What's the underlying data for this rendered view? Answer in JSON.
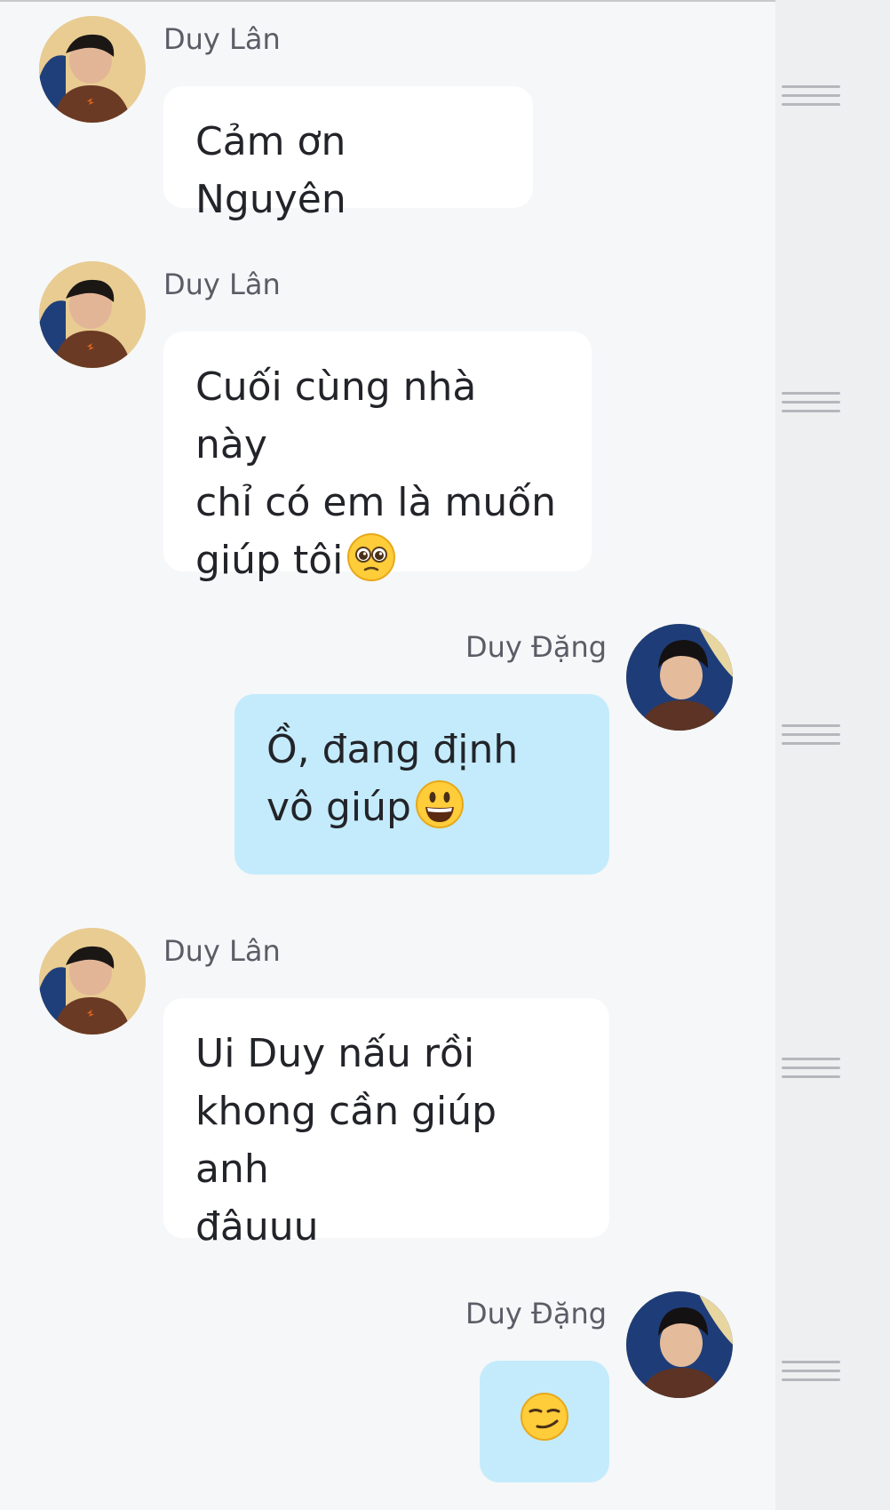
{
  "conversation": {
    "messages": [
      {
        "sender": "Duy Lân",
        "text": "Cảm ơn Nguyên",
        "direction": "incoming",
        "emoji": ""
      },
      {
        "sender": "Duy Lân",
        "text": "Cuối cùng nhà này\nchỉ có em là muốn\ngiúp tôi",
        "direction": "incoming",
        "emoji": "pleading-face"
      },
      {
        "sender": "Duy Đặng",
        "text": "Ồ, đang định\nvô giúp",
        "direction": "outgoing",
        "emoji": "grinning-face"
      },
      {
        "sender": "Duy Lân",
        "text": "Ui Duy nấu rồi\nkhong cần giúp anh\nđâuuu",
        "direction": "incoming",
        "emoji": ""
      },
      {
        "sender": "Duy Đặng",
        "text": "",
        "direction": "outgoing",
        "emoji": "smirking-face"
      }
    ]
  },
  "colors": {
    "background": "#f6f7f9",
    "side_rail": "#eeeff1",
    "incoming_bubble": "#ffffff",
    "outgoing_bubble": "#c4ebfb",
    "sender_text": "#5a5d66",
    "message_text": "#222429",
    "handle": "#b5b7bc"
  },
  "icons": {
    "avatar_incoming": "avatar-duy-lan",
    "avatar_outgoing": "avatar-duy-dang",
    "drag_handle": "drag-handle-icon"
  }
}
